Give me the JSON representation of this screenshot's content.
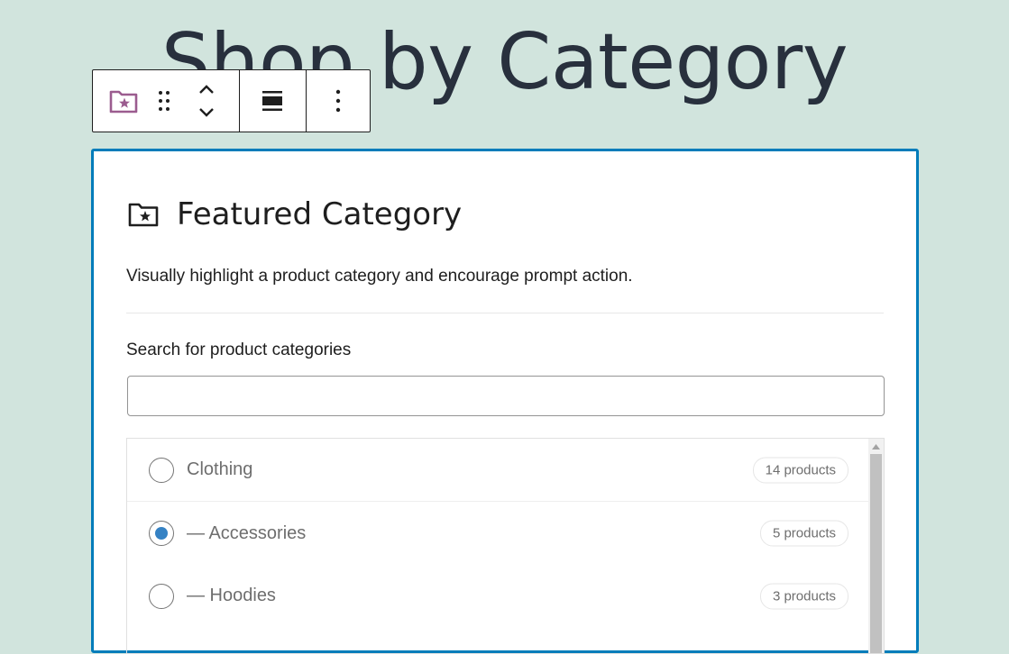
{
  "page": {
    "heading": "Shop by Category"
  },
  "toolbar": {
    "block_icon": "folder-star-icon",
    "drag_icon": "drag-handle-icon",
    "move_up_icon": "chevron-up-icon",
    "move_down_icon": "chevron-down-icon",
    "align_icon": "align-wide-icon",
    "options_icon": "more-vertical-icon",
    "accent_color": "#9b5c8f"
  },
  "block": {
    "icon": "folder-star-icon",
    "title": "Featured Category",
    "description": "Visually highlight a product category and encourage prompt action.",
    "border_color": "#007cba"
  },
  "search": {
    "label": "Search for product categories",
    "value": "",
    "placeholder": ""
  },
  "categories": [
    {
      "label": "Clothing",
      "count": "14 products",
      "selected": false
    },
    {
      "label": "— Accessories",
      "count": "5 products",
      "selected": true
    },
    {
      "label": "— Hoodies",
      "count": "3 products",
      "selected": false
    }
  ]
}
